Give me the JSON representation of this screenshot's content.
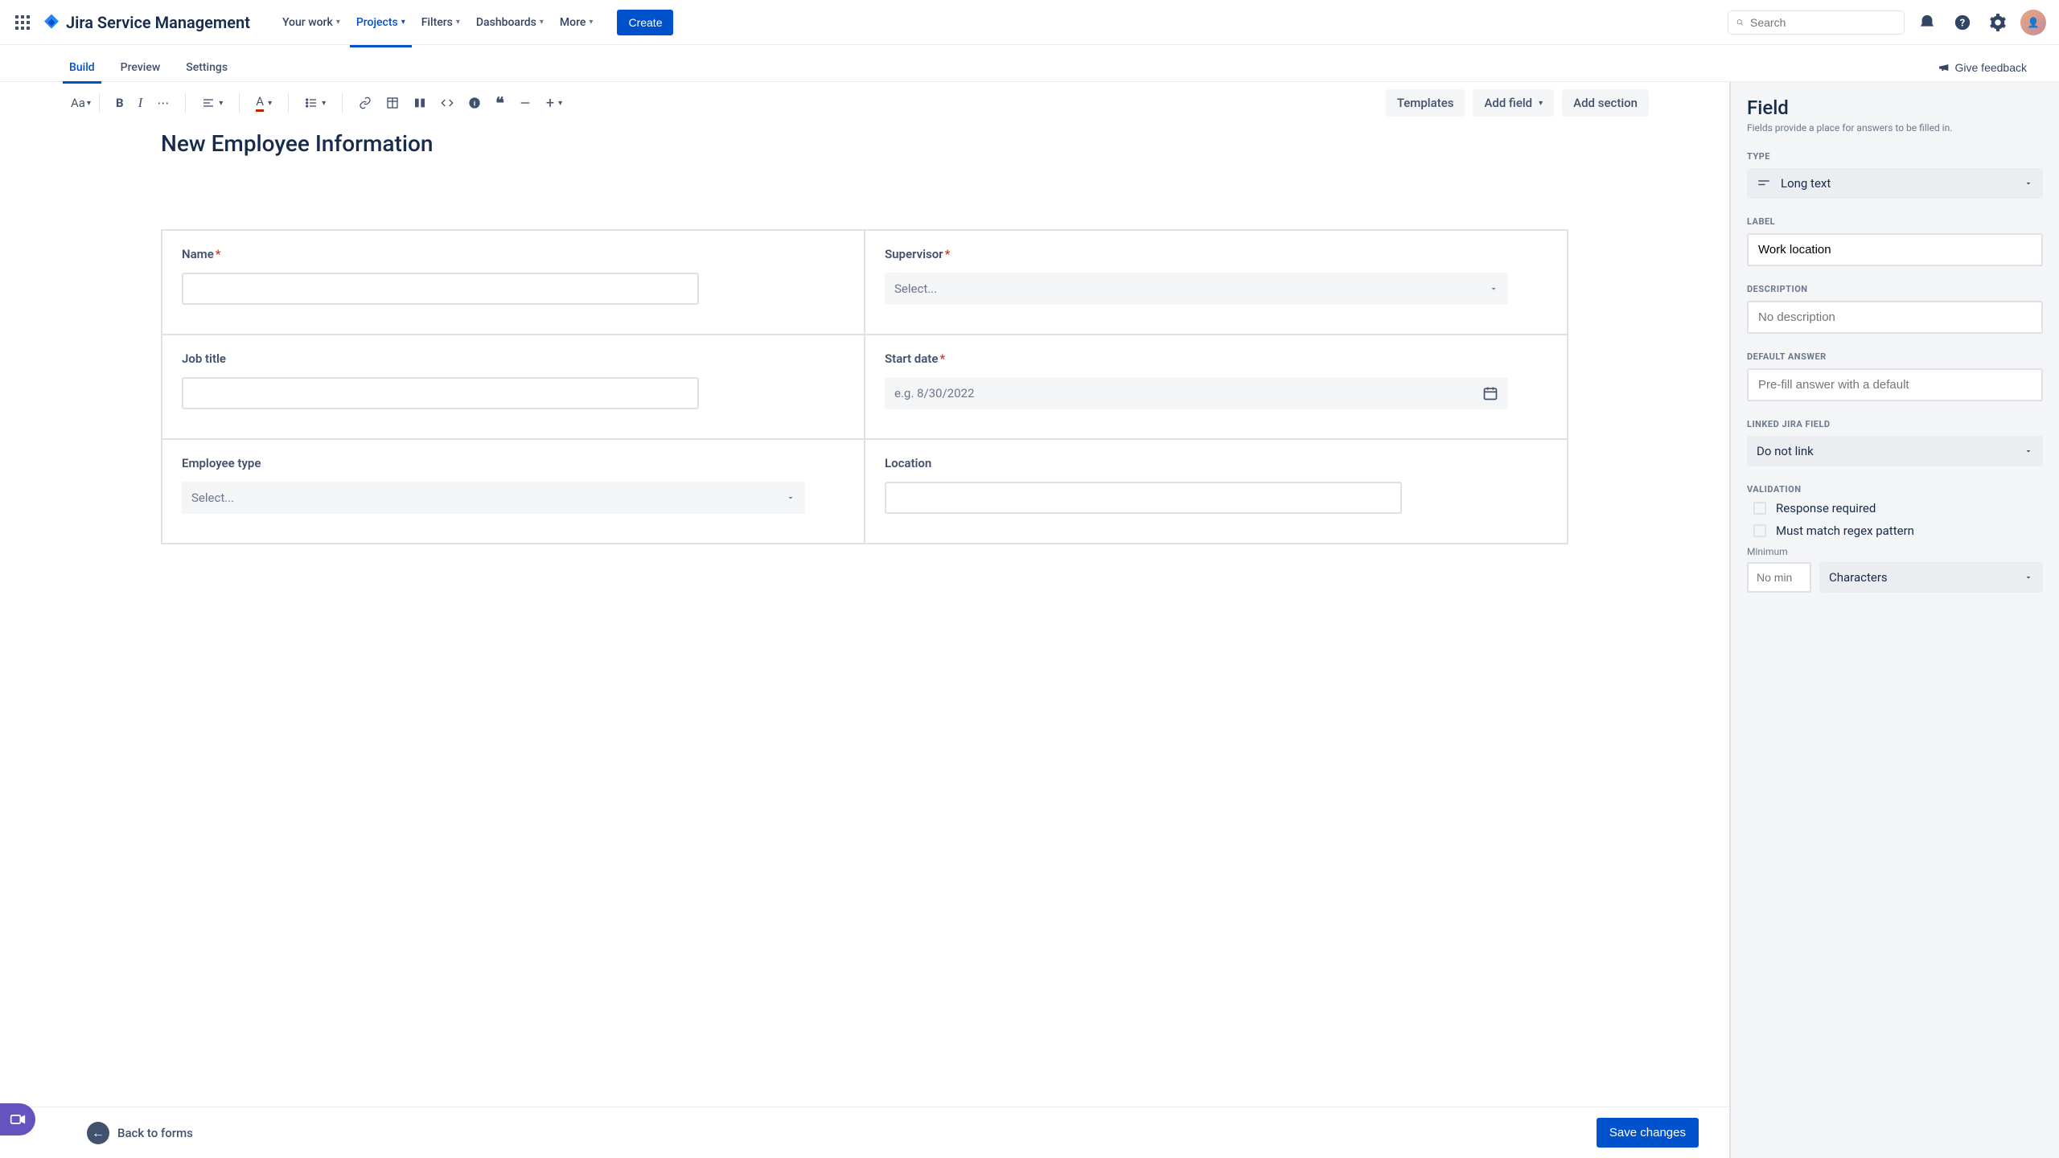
{
  "topnav": {
    "product": "Jira Service Management",
    "items": [
      "Your work",
      "Projects",
      "Filters",
      "Dashboards",
      "More"
    ],
    "active_index": 1,
    "create": "Create",
    "search_placeholder": "Search"
  },
  "tabs": {
    "items": [
      "Build",
      "Preview",
      "Settings"
    ],
    "active_index": 0,
    "feedback": "Give feedback"
  },
  "toolbar": {
    "text_style": "Aa",
    "templates": "Templates",
    "add_field": "Add field",
    "add_section": "Add section"
  },
  "doc": {
    "title": "New Employee Information",
    "fields": {
      "name": {
        "label": "Name",
        "required": true
      },
      "supervisor": {
        "label": "Supervisor",
        "required": true,
        "placeholder": "Select..."
      },
      "job_title": {
        "label": "Job title",
        "required": false
      },
      "start_date": {
        "label": "Start date",
        "required": true,
        "placeholder": "e.g. 8/30/2022"
      },
      "employee_type": {
        "label": "Employee type",
        "required": false,
        "placeholder": "Select..."
      },
      "location": {
        "label": "Location",
        "required": false
      }
    }
  },
  "footer": {
    "back": "Back to forms",
    "save": "Save changes"
  },
  "sidepanel": {
    "title": "Field",
    "subtitle": "Fields provide a place for answers to be filled in.",
    "type_label": "TYPE",
    "type_value": "Long text",
    "label_label": "LABEL",
    "label_value": "Work location",
    "desc_label": "DESCRIPTION",
    "desc_placeholder": "No description",
    "default_label": "DEFAULT ANSWER",
    "default_placeholder": "Pre-fill answer with a default",
    "linked_label": "LINKED JIRA FIELD",
    "linked_value": "Do not link",
    "validation_label": "VALIDATION",
    "check1": "Response required",
    "check2": "Must match regex pattern",
    "min_label": "Minimum",
    "min_placeholder": "No min",
    "min_unit": "Characters"
  }
}
